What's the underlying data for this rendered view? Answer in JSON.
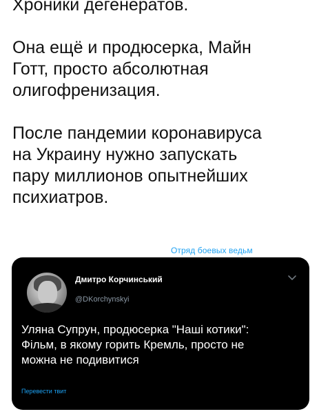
{
  "tweet": {
    "paragraphs": [
      "Хроники дегенератов.",
      "Она ещё и продюсерка, Майн\nГотт, просто абсолютная\nолигофренизация.",
      "После пандемии коронавируса\nна Украину нужно запускать\nпару миллионов опытнейших\nпсихиатров."
    ]
  },
  "watermark": {
    "text": "Отряд боевых ведьм"
  },
  "quoted_tweet": {
    "author_name": "Дмитро Корчинський",
    "author_handle": "@DKorchynskyi",
    "text": "Уляна Супрун, продюсерка \"Наші котики\":\nФільм, в якому горить Кремль, просто не\nможна не подивитися",
    "translate_label": "Перевести твит",
    "caret_icon": "chevron-down-icon",
    "background_color": "#000000",
    "link_color": "#1da1f2"
  }
}
